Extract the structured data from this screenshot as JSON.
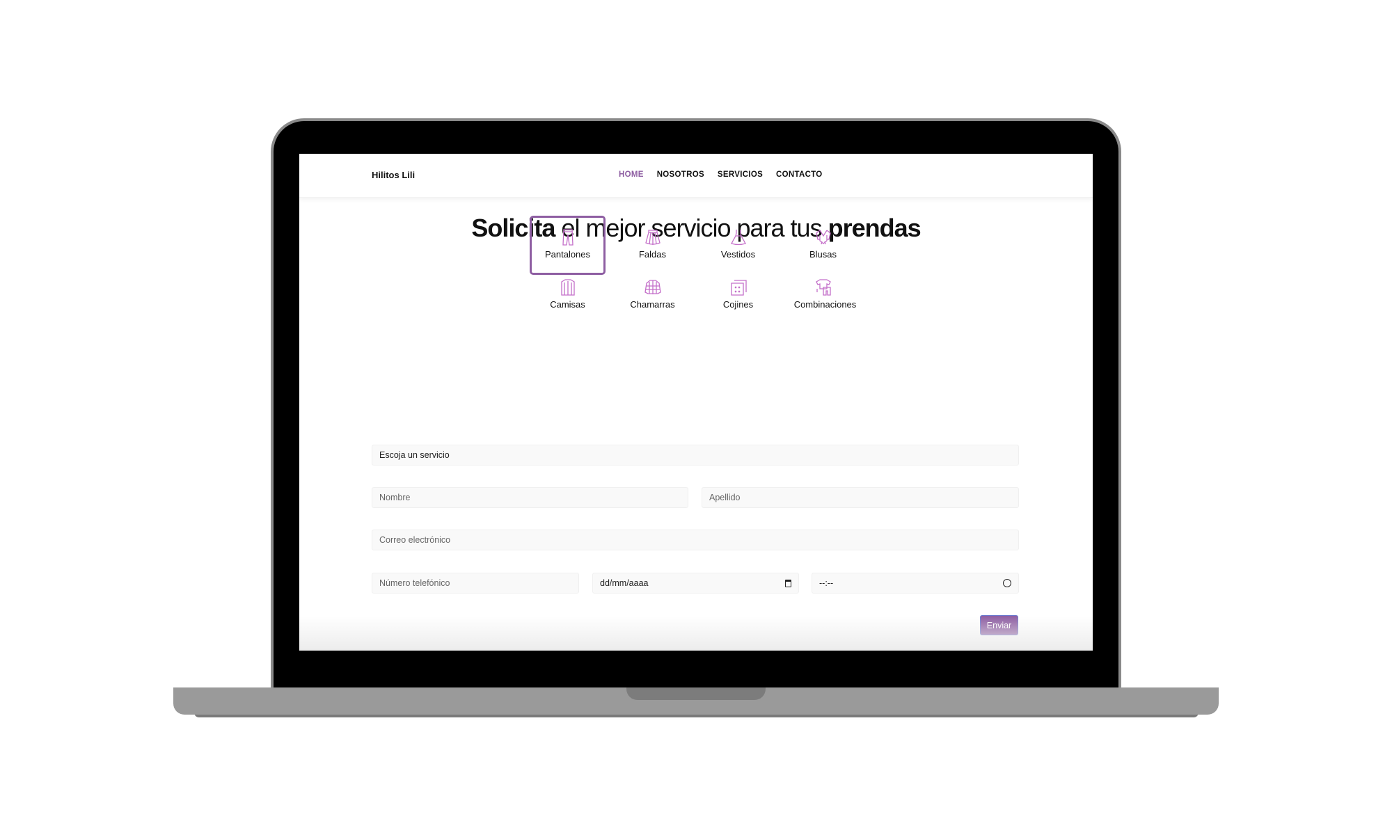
{
  "nav": {
    "brand": "Hilitos Lili",
    "links": [
      "HOME",
      "NOSOTROS",
      "SERVICIOS",
      "CONTACTO"
    ],
    "active": "HOME"
  },
  "heading": {
    "bold1": "Solicita",
    "light": " el mejor servicio para tus ",
    "bold2": "prendas"
  },
  "categories": [
    {
      "label": "Pantalones",
      "icon": "pants-icon",
      "selected": true
    },
    {
      "label": "Faldas",
      "icon": "skirt-icon"
    },
    {
      "label": "Vestidos",
      "icon": "dress-icon"
    },
    {
      "label": "Blusas",
      "icon": "blouse-icon"
    },
    {
      "label": "Camisas",
      "icon": "shirt-icon"
    },
    {
      "label": "Chamarras",
      "icon": "jacket-icon"
    },
    {
      "label": "Cojines",
      "icon": "cushion-icon"
    },
    {
      "label": "Combinaciones",
      "icon": "outfit-icon"
    }
  ],
  "form": {
    "service": "Escoja un servicio",
    "first_name": "Nombre",
    "last_name": "Apellido",
    "email": "Correo electrónico",
    "phone": "Número telefónico",
    "date": "dd/mm/aaaa",
    "time": "--:--",
    "submit": "Enviar"
  },
  "colors": {
    "accent": "#8e5ea2",
    "icon": "#c46fc9"
  }
}
